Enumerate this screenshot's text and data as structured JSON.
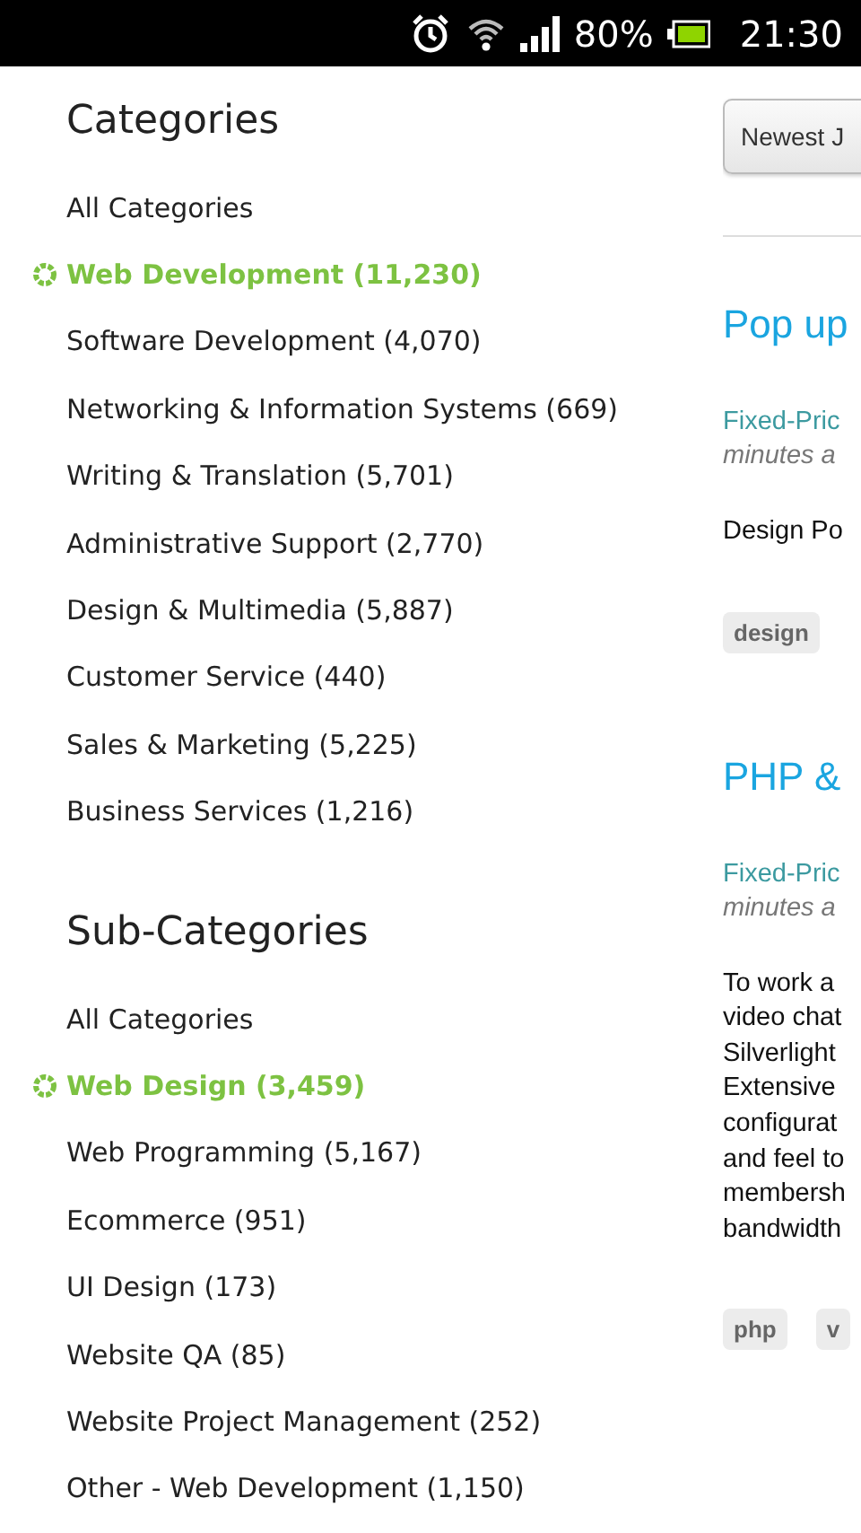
{
  "status_bar": {
    "battery_text": "80%",
    "time": "21:30"
  },
  "categories": {
    "title": "Categories",
    "items": [
      {
        "label": "All Categories",
        "selected": false
      },
      {
        "label": "Web Development (11,230)",
        "selected": true
      },
      {
        "label": "Software Development (4,070)",
        "selected": false
      },
      {
        "label": "Networking & Information Systems (669)",
        "selected": false
      },
      {
        "label": "Writing & Translation (5,701)",
        "selected": false
      },
      {
        "label": "Administrative Support (2,770)",
        "selected": false
      },
      {
        "label": "Design & Multimedia (5,887)",
        "selected": false
      },
      {
        "label": "Customer Service (440)",
        "selected": false
      },
      {
        "label": "Sales & Marketing (5,225)",
        "selected": false
      },
      {
        "label": "Business Services (1,216)",
        "selected": false
      }
    ]
  },
  "sub_categories": {
    "title": "Sub-Categories",
    "items": [
      {
        "label": "All Categories",
        "selected": false
      },
      {
        "label": "Web Design (3,459)",
        "selected": true
      },
      {
        "label": "Web Programming (5,167)",
        "selected": false
      },
      {
        "label": "Ecommerce (951)",
        "selected": false
      },
      {
        "label": "UI Design (173)",
        "selected": false
      },
      {
        "label": "Website QA (85)",
        "selected": false
      },
      {
        "label": "Website Project Management (252)",
        "selected": false
      },
      {
        "label": "Other - Web Development (1,150)",
        "selected": false
      }
    ]
  },
  "sort_button": "Newest J",
  "jobs": [
    {
      "title": "Pop up",
      "type": "Fixed-Pric",
      "posted": "minutes a",
      "description_lines": [
        "Design Po"
      ],
      "tags": [
        "design"
      ]
    },
    {
      "title": "PHP &",
      "type": "Fixed-Pric",
      "posted": "minutes a",
      "description_lines": [
        "To work a",
        "video chat",
        "Silverlight",
        "Extensive",
        "configurat",
        "and feel to",
        "membersh",
        "bandwidth"
      ],
      "tags": [
        "php",
        "v"
      ]
    }
  ]
}
